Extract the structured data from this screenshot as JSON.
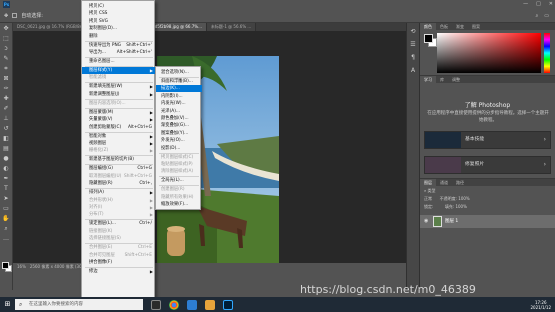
{
  "app": {
    "logo": "Ps",
    "window_controls": [
      "—",
      "□",
      "✕"
    ]
  },
  "optbar": {
    "auto_select_label": "自动选择:",
    "right_icons": [
      "search-icon",
      "workspace-icon"
    ]
  },
  "doc_tabs": [
    "DSC_0621.jpg @ 16.7% (RGB/8#)",
    "a00c1b2bcabd4f5d8b6c82a4bd5f2b98.jpg @ 66.7%...",
    "未标题-1 @ 56.6% ..."
  ],
  "status": {
    "zoom": "16%",
    "info": "2560 像素 x 4000 像素 (300 ppi)"
  },
  "edit_menu": {
    "items": [
      {
        "label": "拷贝(C)",
        "shortcut": "",
        "disabled": false,
        "sub": false
      },
      {
        "label": "拷贝 CSS",
        "shortcut": "",
        "disabled": false,
        "sub": false
      },
      {
        "label": "拷贝 SVG",
        "shortcut": "",
        "disabled": false,
        "sub": false
      },
      {
        "label": "复制图层(D)...",
        "shortcut": "",
        "disabled": false,
        "sub": false
      },
      {
        "label": "删除",
        "shortcut": "",
        "disabled": false,
        "sub": false
      },
      {
        "label": "快速导出为 PNG",
        "shortcut": "Shift+Ctrl+'",
        "disabled": false,
        "sub": false
      },
      {
        "label": "导出为...",
        "shortcut": "Alt+Shift+Ctrl+'",
        "disabled": false,
        "sub": false
      },
      {
        "label": "重命名图层...",
        "shortcut": "",
        "disabled": false,
        "sub": false
      },
      {
        "label": "图层样式(Y)",
        "shortcut": "",
        "disabled": false,
        "sub": true,
        "highlight": true
      },
      {
        "label": "智能滤镜",
        "shortcut": "",
        "disabled": true,
        "sub": false
      },
      {
        "label": "新建填充图层(W)",
        "shortcut": "",
        "disabled": false,
        "sub": true
      },
      {
        "label": "新建调整图层(J)",
        "shortcut": "",
        "disabled": false,
        "sub": true
      },
      {
        "label": "图层内容选项(O)...",
        "shortcut": "",
        "disabled": true,
        "sub": false
      },
      {
        "label": "图层蒙版(M)",
        "shortcut": "",
        "disabled": false,
        "sub": true
      },
      {
        "label": "矢量蒙版(V)",
        "shortcut": "",
        "disabled": false,
        "sub": true
      },
      {
        "label": "创建剪贴蒙版(C)",
        "shortcut": "Alt+Ctrl+G",
        "disabled": false,
        "sub": false
      },
      {
        "label": "智能对象",
        "shortcut": "",
        "disabled": false,
        "sub": true
      },
      {
        "label": "视频图层",
        "shortcut": "",
        "disabled": false,
        "sub": true
      },
      {
        "label": "栅格化(Z)",
        "shortcut": "",
        "disabled": true,
        "sub": true
      },
      {
        "label": "新建基于图层的切片(B)",
        "shortcut": "",
        "disabled": false,
        "sub": false
      },
      {
        "label": "图层编组(G)",
        "shortcut": "Ctrl+G",
        "disabled": false,
        "sub": false
      },
      {
        "label": "取消图层编组(U)",
        "shortcut": "Shift+Ctrl+G",
        "disabled": true,
        "sub": false
      },
      {
        "label": "隐藏图层(R)",
        "shortcut": "Ctrl+,",
        "disabled": false,
        "sub": false
      },
      {
        "label": "排列(A)",
        "shortcut": "",
        "disabled": false,
        "sub": true
      },
      {
        "label": "合并形状(H)",
        "shortcut": "",
        "disabled": true,
        "sub": true
      },
      {
        "label": "对齐(I)",
        "shortcut": "",
        "disabled": true,
        "sub": true
      },
      {
        "label": "分布(T)",
        "shortcut": "",
        "disabled": true,
        "sub": true
      },
      {
        "label": "锁定图层(L)...",
        "shortcut": "Ctrl+/",
        "disabled": false,
        "sub": false
      },
      {
        "label": "链接图层(K)",
        "shortcut": "",
        "disabled": true,
        "sub": false
      },
      {
        "label": "选择链接图层(S)",
        "shortcut": "",
        "disabled": true,
        "sub": false
      },
      {
        "label": "合并图层(E)",
        "shortcut": "Ctrl+E",
        "disabled": true,
        "sub": false
      },
      {
        "label": "合并可见图层",
        "shortcut": "Shift+Ctrl+E",
        "disabled": true,
        "sub": false
      },
      {
        "label": "拼合图像(F)",
        "shortcut": "",
        "disabled": false,
        "sub": false
      },
      {
        "label": "修边",
        "shortcut": "",
        "disabled": false,
        "sub": true
      }
    ]
  },
  "style_submenu": {
    "items": [
      {
        "label": "混合选项(N)...",
        "disabled": false
      },
      {
        "label": "斜面和浮雕(B)...",
        "disabled": false
      },
      {
        "label": "描边(K)...",
        "disabled": false,
        "highlight": true
      },
      {
        "label": "内阴影(I)...",
        "disabled": false
      },
      {
        "label": "内发光(W)...",
        "disabled": false
      },
      {
        "label": "光泽(A)...",
        "disabled": false
      },
      {
        "label": "颜色叠加(V)...",
        "disabled": false
      },
      {
        "label": "渐变叠加(G)...",
        "disabled": false
      },
      {
        "label": "图案叠加(Y)...",
        "disabled": false
      },
      {
        "label": "外发光(O)...",
        "disabled": false
      },
      {
        "label": "投影(D)...",
        "disabled": false
      },
      {
        "label": "拷贝图层样式(C)",
        "disabled": true
      },
      {
        "label": "粘贴图层样式(P)",
        "disabled": true
      },
      {
        "label": "清除图层样式(A)",
        "disabled": true
      },
      {
        "label": "全局光(L)...",
        "disabled": false
      },
      {
        "label": "创建图层(R)",
        "disabled": true
      },
      {
        "label": "隐藏所有效果(H)",
        "disabled": true
      },
      {
        "label": "缩放效果(F)...",
        "disabled": false
      }
    ]
  },
  "color_panel": {
    "tabs": [
      "颜色",
      "色板",
      "渐变",
      "图案"
    ]
  },
  "learn_panel": {
    "tabs": [
      "学习",
      "库",
      "调整"
    ],
    "title": "了解 Photoshop",
    "subtitle": "在应用程序中直接使用提供的分步指导教程。选择一个主题开始教程。",
    "cards": [
      {
        "label": "基本技能"
      },
      {
        "label": "修复照片"
      }
    ]
  },
  "layers_panel": {
    "tabs": [
      "图层",
      "通道",
      "路径"
    ],
    "kind_label": "类型",
    "mode": "正常",
    "opacity_label": "不透明度:",
    "opacity": "100%",
    "lock_label": "锁定:",
    "fill_label": "填充:",
    "fill": "100%",
    "layer_name": "图层 1"
  },
  "taskbar": {
    "search_placeholder": "在这里输入你要搜索的内容",
    "time": "17:26",
    "date": "2021/1/12"
  },
  "watermark": "https://blog.csdn.net/m0_46389"
}
